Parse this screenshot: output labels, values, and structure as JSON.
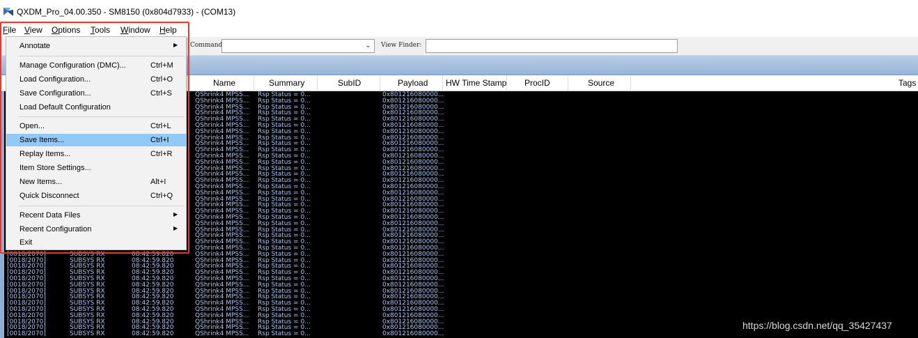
{
  "window": {
    "title": "QXDM_Pro_04.00.350 - SM8150 (0x804d7933) - (COM13)"
  },
  "menubar": {
    "items": [
      {
        "label": "File",
        "mnemonic": "F"
      },
      {
        "label": "View",
        "mnemonic": "V"
      },
      {
        "label": "Options",
        "mnemonic": "O"
      },
      {
        "label": "Tools",
        "mnemonic": "T"
      },
      {
        "label": "Window",
        "mnemonic": "W"
      },
      {
        "label": "Help",
        "mnemonic": "H"
      }
    ]
  },
  "toolbar": {
    "command_label": "Command:",
    "command_value": "",
    "viewfinder_label": "View Finder:",
    "viewfinder_value": ""
  },
  "file_menu": {
    "items": [
      {
        "label": "Annotate",
        "shortcut": "",
        "submenu": true
      },
      {
        "label": "Manage Configuration (DMC)...",
        "shortcut": "Ctrl+M"
      },
      {
        "label": "Load Configuration...",
        "shortcut": "Ctrl+O"
      },
      {
        "label": "Save Configuration...",
        "shortcut": "Ctrl+S"
      },
      {
        "label": "Load Default Configuration",
        "shortcut": ""
      },
      {
        "label": "Open...",
        "shortcut": "Ctrl+L"
      },
      {
        "label": "Save Items...",
        "shortcut": "Ctrl+I",
        "highlighted": true
      },
      {
        "label": "Replay Items...",
        "shortcut": "Ctrl+R"
      },
      {
        "label": "Item Store Settings...",
        "shortcut": ""
      },
      {
        "label": "New Items...",
        "shortcut": "Alt+I"
      },
      {
        "label": "Quick Disconnect",
        "shortcut": "Ctrl+Q"
      },
      {
        "label": "Recent Data Files",
        "shortcut": "",
        "submenu": true
      },
      {
        "label": "Recent Configuration",
        "shortcut": "",
        "submenu": true
      },
      {
        "label": "Exit",
        "shortcut": ""
      }
    ]
  },
  "columns": [
    "Name",
    "Summary",
    "SubID",
    "Payload",
    "HW Time Stamp",
    "ProcID",
    "Source",
    "Tags"
  ],
  "log": {
    "id": "[0018/2070]",
    "type": "SUBSYS RX",
    "time": "08:42:59.820",
    "name": "QShrink4 MPSS...",
    "summary": "Rsp Status = 0...",
    "payload": "0x801216080000..."
  },
  "watermark": "https://blog.csdn.net/qq_35427437",
  "colors": {
    "highlight": "#91c9f7",
    "red_frame": "#e33a32",
    "log_text": "#a9c6f5",
    "log_bg": "#000000"
  }
}
